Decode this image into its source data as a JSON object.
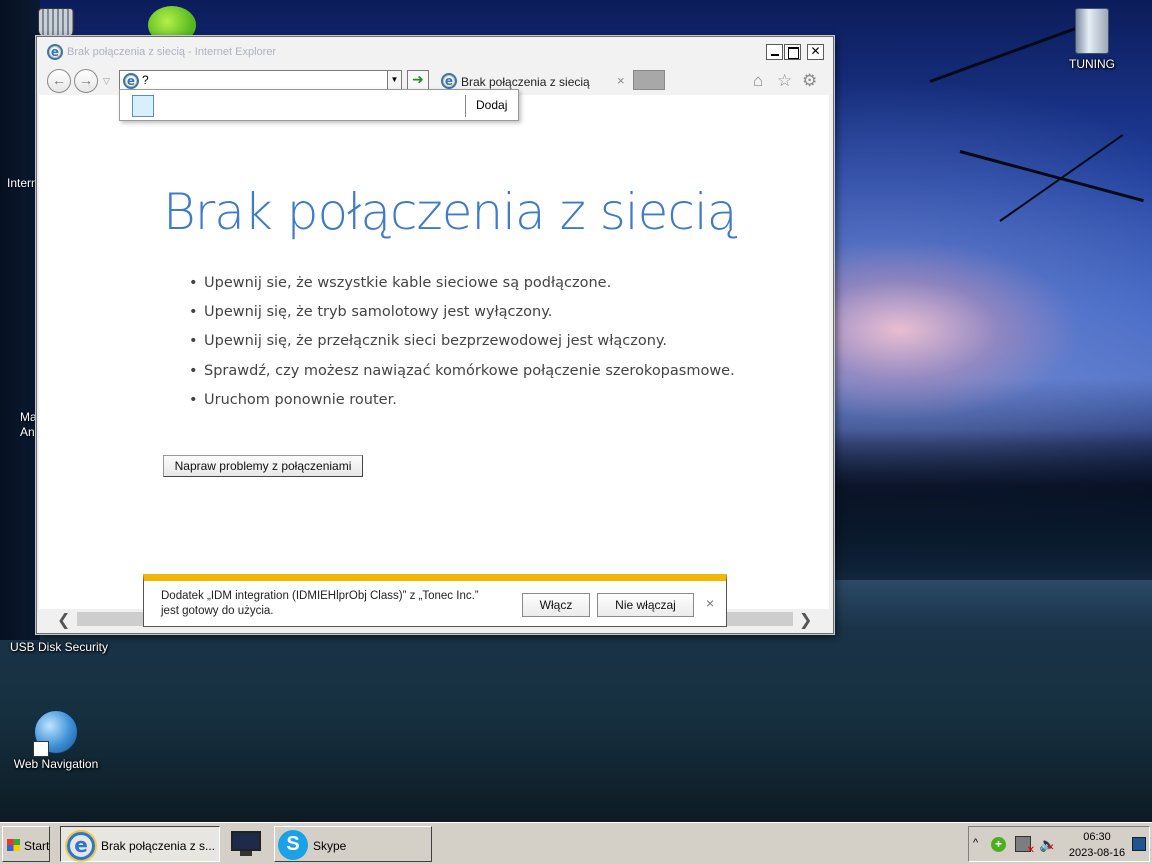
{
  "desktop": {
    "icons": {
      "tuning": "TUNING",
      "usb_disk_security": "USB Disk Security",
      "web_navigation": "Web Navigation"
    },
    "partial_labels": {
      "internet": "Intern",
      "ma_line1": "Ma",
      "ma_line2": "An"
    }
  },
  "browser": {
    "window_title": "Brak połączenia z siecią - Internet Explorer",
    "address": "?",
    "tab_title": "Brak połączenia z siecią",
    "tab_close": "×",
    "favorites_popup": {
      "add_label": "Dodaj"
    },
    "content": {
      "heading": "Brak połączenia z siecią",
      "tips": [
        "Upewnij sie, że wszystkie kable sieciowe są podłączone.",
        "Upewnij się, że tryb samolotowy jest wyłączony.",
        "Upewnij się, że przełącznik sieci bezprzewodowej jest włączony.",
        "Sprawdź, czy możesz nawiązać komórkowe połączenie szerokopasmowe.",
        "Uruchom ponownie router."
      ],
      "fix_button": "Napraw problemy z połączeniami"
    },
    "notification": {
      "line1": "Dodatek „IDM integration (IDMIEHlprObj Class)” z „Tonec Inc.”",
      "line2": "jest gotowy do użycia.",
      "enable_label": "Włącz",
      "disable_label": "Nie włączaj",
      "close": "×"
    }
  },
  "taskbar": {
    "start_label": "Start",
    "ie_task_label": "Brak połączenia z s...",
    "skype_label": "Skype",
    "tray": {
      "expand": "^",
      "time": "06:30",
      "date": "2023-08-16"
    }
  },
  "colors": {
    "heading_blue": "#3f7bc8",
    "notification_accent": "#f2b705",
    "taskbar_gray": "#d4d0c8"
  },
  "icons": [
    "recycle-bin-icon",
    "green-plus-icon",
    "folder-icon",
    "ie-icon",
    "globe-icon",
    "home-icon",
    "star-icon",
    "gear-icon",
    "skype-icon",
    "computer-icon",
    "network-error-icon",
    "volume-muted-icon"
  ]
}
